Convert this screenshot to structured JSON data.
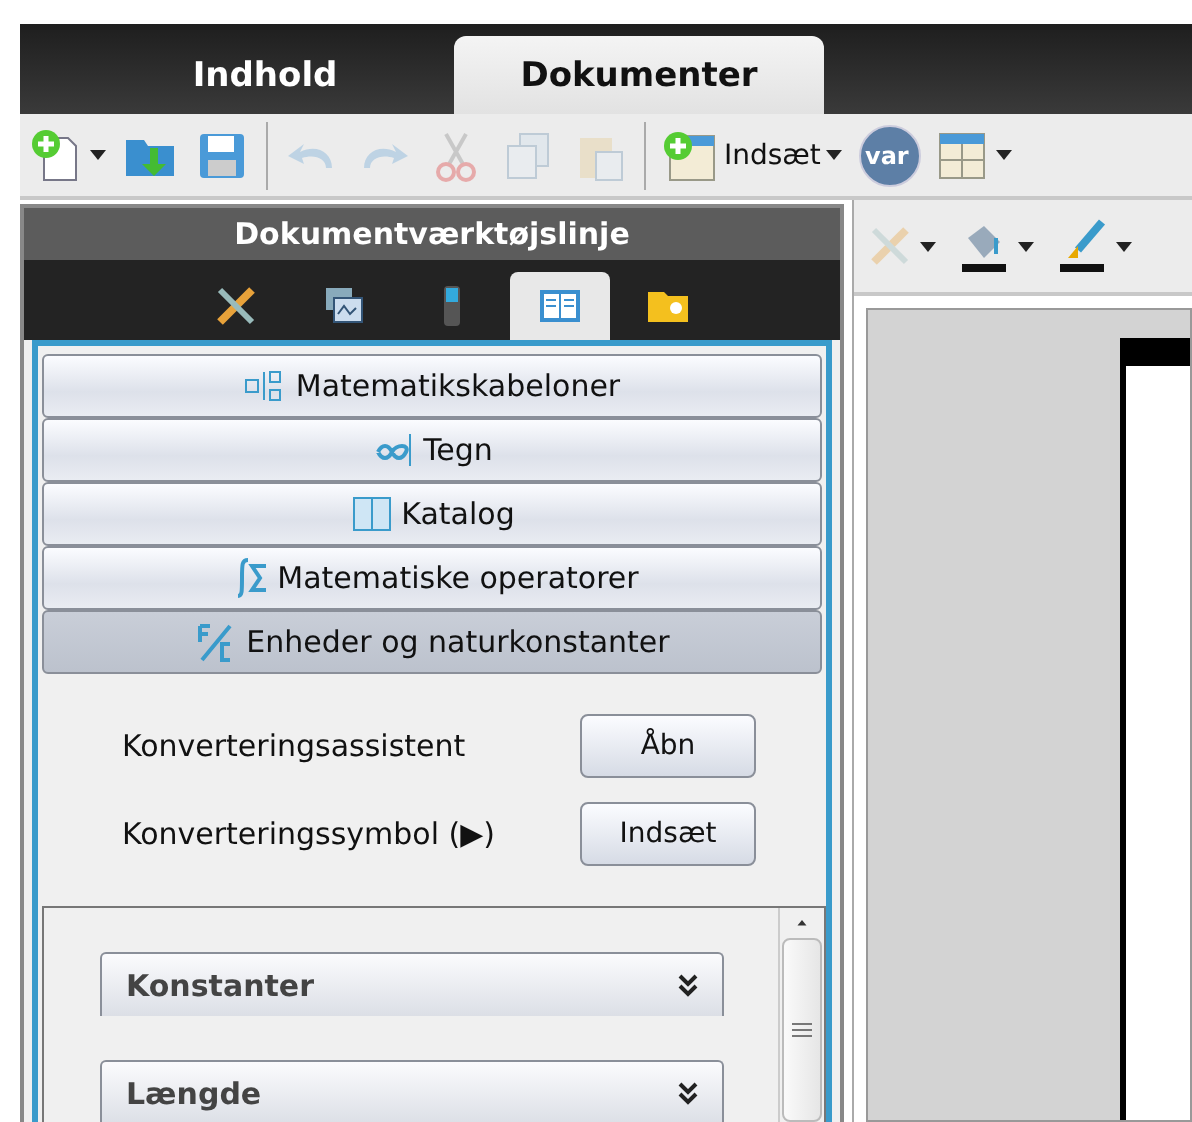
{
  "tabs": [
    {
      "label": "Indhold",
      "selected": false
    },
    {
      "label": "Dokumenter",
      "selected": true
    }
  ],
  "toolbar": [
    {
      "kind": "new",
      "disabled": false,
      "dropdown": true
    },
    {
      "kind": "open",
      "disabled": false,
      "dropdown": false
    },
    {
      "kind": "save",
      "disabled": false,
      "dropdown": false
    },
    {
      "kind": "separator"
    },
    {
      "kind": "undo",
      "disabled": true,
      "dropdown": false
    },
    {
      "kind": "redo",
      "disabled": true,
      "dropdown": false
    },
    {
      "kind": "cut",
      "disabled": true,
      "dropdown": false
    },
    {
      "kind": "copy",
      "disabled": true,
      "dropdown": false
    },
    {
      "kind": "paste",
      "disabled": true,
      "dropdown": false
    },
    {
      "kind": "separator"
    },
    {
      "kind": "insert",
      "disabled": false,
      "dropdown": true,
      "label": "Indsæt"
    },
    {
      "kind": "var",
      "disabled": false,
      "dropdown": false,
      "label": "var"
    },
    {
      "kind": "layout",
      "disabled": false,
      "dropdown": true
    }
  ],
  "panel": {
    "title": "Dokumentværktøjslinje",
    "tool_tabs": [
      {
        "kind": "tools",
        "selected": false
      },
      {
        "kind": "pages",
        "selected": false
      },
      {
        "kind": "device",
        "selected": false
      },
      {
        "kind": "book",
        "selected": true
      },
      {
        "kind": "folder",
        "selected": false
      }
    ],
    "sections": [
      {
        "kind": "templates",
        "label": "Matematikskabeloner",
        "selected": false
      },
      {
        "kind": "symbols",
        "label": "Tegn",
        "selected": false
      },
      {
        "kind": "catalog",
        "label": "Katalog",
        "selected": false
      },
      {
        "kind": "operators",
        "label": "Matematiske operatorer",
        "selected": false
      },
      {
        "kind": "units",
        "label": "Enheder og naturkonstanter",
        "selected": true
      }
    ],
    "actions": [
      {
        "label": "Konverteringsassistent",
        "button": "Åbn"
      },
      {
        "label": "Konverteringssymbol (▶)",
        "button": "Indsæt"
      }
    ],
    "categories": [
      {
        "label": "Konstanter"
      },
      {
        "label": "Længde"
      }
    ]
  },
  "doc_toolbar": [
    {
      "kind": "tools",
      "disabled": true
    },
    {
      "kind": "fill",
      "disabled": false
    },
    {
      "kind": "pen",
      "disabled": false
    }
  ]
}
